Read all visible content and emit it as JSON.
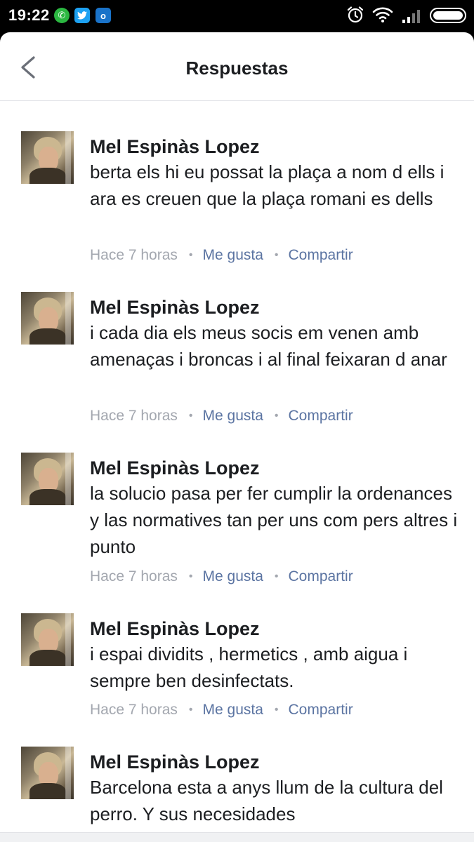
{
  "status_bar": {
    "time": "19:22",
    "notification_icons": [
      "whatsapp-icon",
      "twitter-icon",
      "outlook-icon"
    ],
    "right_icons": [
      "alarm-icon",
      "wifi-icon",
      "signal-icon",
      "battery-icon"
    ]
  },
  "header": {
    "back_icon": "chevron-left-icon",
    "title": "Respuestas"
  },
  "comments": [
    {
      "author": "Mel Espinàs Lopez",
      "text": "berta els hi eu possat la plaça a nom d ells i ara es creuen que la plaça romani es dells",
      "time": "Hace 7 horas",
      "like": "Me gusta",
      "share": "Compartir"
    },
    {
      "author": "Mel Espinàs Lopez",
      "text": "i cada dia els meus socis em venen amb amenaças i broncas i al final feixaran d anar",
      "time": "Hace 7 horas",
      "like": "Me gusta",
      "share": "Compartir"
    },
    {
      "author": "Mel Espinàs Lopez",
      "text": "la solucio pasa per fer cumplir la ordenances y las normatives tan per uns com pers altres i punto",
      "time": "Hace 7 horas",
      "like": "Me gusta",
      "share": "Compartir"
    },
    {
      "author": "Mel Espinàs Lopez",
      "text": "i espai dividits , hermetics , amb aigua i sempre ben desinfectats.",
      "time": "Hace 7 horas",
      "like": "Me gusta",
      "share": "Compartir"
    },
    {
      "author": "Mel Espinàs Lopez",
      "text": "Barcelona esta a anys llum de la cultura del perro. Y sus necesidades",
      "time": "",
      "like": "",
      "share": ""
    }
  ],
  "colors": {
    "link": "#5b74a2",
    "meta": "#a3a7af",
    "text": "#1c1e21"
  }
}
